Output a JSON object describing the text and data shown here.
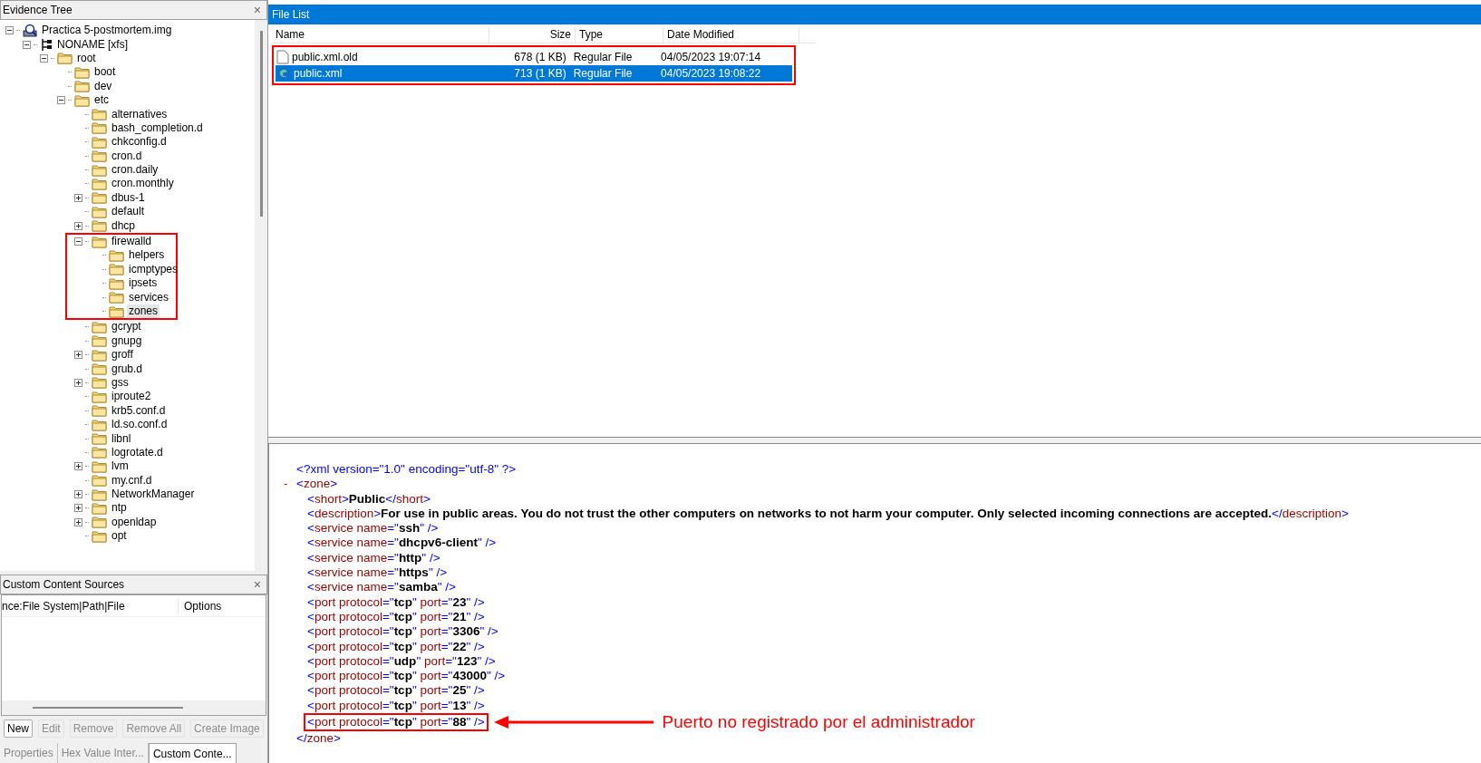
{
  "evidence_tree": {
    "title": "Evidence Tree",
    "close": "×",
    "nodes": [
      {
        "label": "Practica 5-postmortem.img",
        "kind": "image",
        "expanded": true,
        "selected": false,
        "highlighted": false,
        "children": [
          {
            "label": "NONAME [xfs]",
            "kind": "volume",
            "expanded": true,
            "selected": false,
            "highlighted": false,
            "children": [
              {
                "label": "root",
                "kind": "folder",
                "expanded": true,
                "selected": false,
                "highlighted": false,
                "children": [
                  {
                    "label": "boot",
                    "kind": "folder",
                    "selected": false,
                    "highlighted": false
                  },
                  {
                    "label": "dev",
                    "kind": "folder",
                    "selected": false,
                    "highlighted": false
                  },
                  {
                    "label": "etc",
                    "kind": "folder",
                    "expanded": true,
                    "selected": false,
                    "highlighted": false,
                    "children": [
                      {
                        "label": "alternatives",
                        "kind": "folder",
                        "selected": false,
                        "highlighted": false
                      },
                      {
                        "label": "bash_completion.d",
                        "kind": "folder",
                        "selected": false,
                        "highlighted": false
                      },
                      {
                        "label": "chkconfig.d",
                        "kind": "folder",
                        "selected": false,
                        "highlighted": false
                      },
                      {
                        "label": "cron.d",
                        "kind": "folder",
                        "selected": false,
                        "highlighted": false
                      },
                      {
                        "label": "cron.daily",
                        "kind": "folder",
                        "selected": false,
                        "highlighted": false
                      },
                      {
                        "label": "cron.monthly",
                        "kind": "folder",
                        "selected": false,
                        "highlighted": false
                      },
                      {
                        "label": "dbus-1",
                        "kind": "folder",
                        "expanded": false,
                        "selected": false,
                        "highlighted": false
                      },
                      {
                        "label": "default",
                        "kind": "folder",
                        "selected": false,
                        "highlighted": false
                      },
                      {
                        "label": "dhcp",
                        "kind": "folder",
                        "expanded": false,
                        "selected": false,
                        "highlighted": false
                      },
                      {
                        "label": "firewalld",
                        "kind": "folder",
                        "expanded": true,
                        "selected": false,
                        "highlighted": true,
                        "children": [
                          {
                            "label": "helpers",
                            "kind": "folder",
                            "selected": false,
                            "highlighted": false
                          },
                          {
                            "label": "icmptypes",
                            "kind": "folder",
                            "selected": false,
                            "highlighted": false
                          },
                          {
                            "label": "ipsets",
                            "kind": "folder",
                            "selected": false,
                            "highlighted": false
                          },
                          {
                            "label": "services",
                            "kind": "folder",
                            "selected": false,
                            "highlighted": false
                          },
                          {
                            "label": "zones",
                            "kind": "folder",
                            "selected": true,
                            "highlighted": false
                          }
                        ]
                      },
                      {
                        "label": "gcrypt",
                        "kind": "folder",
                        "selected": false,
                        "highlighted": false
                      },
                      {
                        "label": "gnupg",
                        "kind": "folder",
                        "selected": false,
                        "highlighted": false
                      },
                      {
                        "label": "groff",
                        "kind": "folder",
                        "expanded": false,
                        "selected": false,
                        "highlighted": false
                      },
                      {
                        "label": "grub.d",
                        "kind": "folder",
                        "selected": false,
                        "highlighted": false
                      },
                      {
                        "label": "gss",
                        "kind": "folder",
                        "expanded": false,
                        "selected": false,
                        "highlighted": false
                      },
                      {
                        "label": "iproute2",
                        "kind": "folder",
                        "selected": false,
                        "highlighted": false
                      },
                      {
                        "label": "krb5.conf.d",
                        "kind": "folder",
                        "selected": false,
                        "highlighted": false
                      },
                      {
                        "label": "ld.so.conf.d",
                        "kind": "folder",
                        "selected": false,
                        "highlighted": false
                      },
                      {
                        "label": "libnl",
                        "kind": "folder",
                        "selected": false,
                        "highlighted": false
                      },
                      {
                        "label": "logrotate.d",
                        "kind": "folder",
                        "selected": false,
                        "highlighted": false
                      },
                      {
                        "label": "lvm",
                        "kind": "folder",
                        "expanded": false,
                        "selected": false,
                        "highlighted": false
                      },
                      {
                        "label": "my.cnf.d",
                        "kind": "folder",
                        "selected": false,
                        "highlighted": false
                      },
                      {
                        "label": "NetworkManager",
                        "kind": "folder",
                        "expanded": false,
                        "selected": false,
                        "highlighted": false
                      },
                      {
                        "label": "ntp",
                        "kind": "folder",
                        "expanded": false,
                        "selected": false,
                        "highlighted": false
                      },
                      {
                        "label": "openldap",
                        "kind": "folder",
                        "expanded": false,
                        "selected": false,
                        "highlighted": false
                      },
                      {
                        "label": "opt",
                        "kind": "folder",
                        "selected": false,
                        "highlighted": false
                      }
                    ]
                  }
                ]
              }
            ]
          }
        ]
      }
    ]
  },
  "custom_content_sources": {
    "title": "Custom Content Sources",
    "close": "×",
    "columns": [
      "nce:File System|Path|File",
      "Options"
    ],
    "buttons": [
      {
        "label": "New",
        "disabled": false
      },
      {
        "label": "Edit",
        "disabled": true
      },
      {
        "label": "Remove",
        "disabled": true
      },
      {
        "label": "Remove All",
        "disabled": true
      },
      {
        "label": "Create Image",
        "disabled": true
      }
    ]
  },
  "bottom_tabs": [
    {
      "label": "Properties",
      "selected": false
    },
    {
      "label": "Hex Value Inter...",
      "selected": false
    },
    {
      "label": "Custom Conte...",
      "selected": true
    }
  ],
  "file_list": {
    "title": "File List",
    "columns": [
      "Name",
      "Size",
      "Type",
      "Date Modified"
    ],
    "highlighted": true,
    "rows": [
      {
        "name": "public.xml.old",
        "kind": "document",
        "size": "678 (1 KB)",
        "type": "Regular File",
        "date": "04/05/2023 19:07:14",
        "selected": false
      },
      {
        "name": "public.xml",
        "kind": "web",
        "size": "713 (1 KB)",
        "type": "Regular File",
        "date": "04/05/2023 19:08:22",
        "selected": true
      }
    ]
  },
  "xml_view": {
    "declaration": [
      {
        "kind": "punct",
        "text": "<?"
      },
      {
        "kind": "punct",
        "text": "xml version=\"1.0\" encoding=\"utf-8\" ?>"
      }
    ],
    "root": {
      "toggle": "-",
      "open": [
        {
          "kind": "punct",
          "text": "<"
        },
        {
          "kind": "name",
          "text": "zone"
        },
        {
          "kind": "punct",
          "text": ">"
        }
      ],
      "lines": [
        {
          "highlighted": false,
          "segments": [
            {
              "kind": "punct",
              "text": "<"
            },
            {
              "kind": "name",
              "text": "short"
            },
            {
              "kind": "punct",
              "text": ">"
            },
            {
              "kind": "value",
              "text": "Public"
            },
            {
              "kind": "punct",
              "text": "</"
            },
            {
              "kind": "name",
              "text": "short"
            },
            {
              "kind": "punct",
              "text": ">"
            }
          ]
        },
        {
          "highlighted": false,
          "segments": [
            {
              "kind": "punct",
              "text": "<"
            },
            {
              "kind": "name",
              "text": "description"
            },
            {
              "kind": "punct",
              "text": ">"
            },
            {
              "kind": "value",
              "text": "For use in public areas. You do not trust the other computers on networks to not harm your computer. Only selected incoming connections are accepted."
            },
            {
              "kind": "punct",
              "text": "</"
            },
            {
              "kind": "name",
              "text": "description"
            },
            {
              "kind": "punct",
              "text": ">"
            }
          ]
        },
        {
          "highlighted": false,
          "segments": [
            {
              "kind": "punct",
              "text": "<"
            },
            {
              "kind": "name",
              "text": "service name"
            },
            {
              "kind": "punct",
              "text": "=\""
            },
            {
              "kind": "value",
              "text": "ssh"
            },
            {
              "kind": "punct",
              "text": "\" />"
            }
          ]
        },
        {
          "highlighted": false,
          "segments": [
            {
              "kind": "punct",
              "text": "<"
            },
            {
              "kind": "name",
              "text": "service name"
            },
            {
              "kind": "punct",
              "text": "=\""
            },
            {
              "kind": "value",
              "text": "dhcpv6-client"
            },
            {
              "kind": "punct",
              "text": "\" />"
            }
          ]
        },
        {
          "highlighted": false,
          "segments": [
            {
              "kind": "punct",
              "text": "<"
            },
            {
              "kind": "name",
              "text": "service name"
            },
            {
              "kind": "punct",
              "text": "=\""
            },
            {
              "kind": "value",
              "text": "http"
            },
            {
              "kind": "punct",
              "text": "\" />"
            }
          ]
        },
        {
          "highlighted": false,
          "segments": [
            {
              "kind": "punct",
              "text": "<"
            },
            {
              "kind": "name",
              "text": "service name"
            },
            {
              "kind": "punct",
              "text": "=\""
            },
            {
              "kind": "value",
              "text": "https"
            },
            {
              "kind": "punct",
              "text": "\" />"
            }
          ]
        },
        {
          "highlighted": false,
          "segments": [
            {
              "kind": "punct",
              "text": "<"
            },
            {
              "kind": "name",
              "text": "service name"
            },
            {
              "kind": "punct",
              "text": "=\""
            },
            {
              "kind": "value",
              "text": "samba"
            },
            {
              "kind": "punct",
              "text": "\" />"
            }
          ]
        },
        {
          "highlighted": false,
          "segments": [
            {
              "kind": "punct",
              "text": "<"
            },
            {
              "kind": "name",
              "text": "port protocol"
            },
            {
              "kind": "punct",
              "text": "=\""
            },
            {
              "kind": "value",
              "text": "tcp"
            },
            {
              "kind": "punct",
              "text": "\""
            },
            {
              "kind": "name",
              "text": " port"
            },
            {
              "kind": "punct",
              "text": "=\""
            },
            {
              "kind": "value",
              "text": "23"
            },
            {
              "kind": "punct",
              "text": "\" />"
            }
          ]
        },
        {
          "highlighted": false,
          "segments": [
            {
              "kind": "punct",
              "text": "<"
            },
            {
              "kind": "name",
              "text": "port protocol"
            },
            {
              "kind": "punct",
              "text": "=\""
            },
            {
              "kind": "value",
              "text": "tcp"
            },
            {
              "kind": "punct",
              "text": "\""
            },
            {
              "kind": "name",
              "text": " port"
            },
            {
              "kind": "punct",
              "text": "=\""
            },
            {
              "kind": "value",
              "text": "21"
            },
            {
              "kind": "punct",
              "text": "\" />"
            }
          ]
        },
        {
          "highlighted": false,
          "segments": [
            {
              "kind": "punct",
              "text": "<"
            },
            {
              "kind": "name",
              "text": "port protocol"
            },
            {
              "kind": "punct",
              "text": "=\""
            },
            {
              "kind": "value",
              "text": "tcp"
            },
            {
              "kind": "punct",
              "text": "\""
            },
            {
              "kind": "name",
              "text": " port"
            },
            {
              "kind": "punct",
              "text": "=\""
            },
            {
              "kind": "value",
              "text": "3306"
            },
            {
              "kind": "punct",
              "text": "\" />"
            }
          ]
        },
        {
          "highlighted": false,
          "segments": [
            {
              "kind": "punct",
              "text": "<"
            },
            {
              "kind": "name",
              "text": "port protocol"
            },
            {
              "kind": "punct",
              "text": "=\""
            },
            {
              "kind": "value",
              "text": "tcp"
            },
            {
              "kind": "punct",
              "text": "\""
            },
            {
              "kind": "name",
              "text": " port"
            },
            {
              "kind": "punct",
              "text": "=\""
            },
            {
              "kind": "value",
              "text": "22"
            },
            {
              "kind": "punct",
              "text": "\" />"
            }
          ]
        },
        {
          "highlighted": false,
          "segments": [
            {
              "kind": "punct",
              "text": "<"
            },
            {
              "kind": "name",
              "text": "port protocol"
            },
            {
              "kind": "punct",
              "text": "=\""
            },
            {
              "kind": "value",
              "text": "udp"
            },
            {
              "kind": "punct",
              "text": "\""
            },
            {
              "kind": "name",
              "text": " port"
            },
            {
              "kind": "punct",
              "text": "=\""
            },
            {
              "kind": "value",
              "text": "123"
            },
            {
              "kind": "punct",
              "text": "\" />"
            }
          ]
        },
        {
          "highlighted": false,
          "segments": [
            {
              "kind": "punct",
              "text": "<"
            },
            {
              "kind": "name",
              "text": "port protocol"
            },
            {
              "kind": "punct",
              "text": "=\""
            },
            {
              "kind": "value",
              "text": "tcp"
            },
            {
              "kind": "punct",
              "text": "\""
            },
            {
              "kind": "name",
              "text": " port"
            },
            {
              "kind": "punct",
              "text": "=\""
            },
            {
              "kind": "value",
              "text": "43000"
            },
            {
              "kind": "punct",
              "text": "\" />"
            }
          ]
        },
        {
          "highlighted": false,
          "segments": [
            {
              "kind": "punct",
              "text": "<"
            },
            {
              "kind": "name",
              "text": "port protocol"
            },
            {
              "kind": "punct",
              "text": "=\""
            },
            {
              "kind": "value",
              "text": "tcp"
            },
            {
              "kind": "punct",
              "text": "\""
            },
            {
              "kind": "name",
              "text": " port"
            },
            {
              "kind": "punct",
              "text": "=\""
            },
            {
              "kind": "value",
              "text": "25"
            },
            {
              "kind": "punct",
              "text": "\" />"
            }
          ]
        },
        {
          "highlighted": false,
          "segments": [
            {
              "kind": "punct",
              "text": "<"
            },
            {
              "kind": "name",
              "text": "port protocol"
            },
            {
              "kind": "punct",
              "text": "=\""
            },
            {
              "kind": "value",
              "text": "tcp"
            },
            {
              "kind": "punct",
              "text": "\""
            },
            {
              "kind": "name",
              "text": " port"
            },
            {
              "kind": "punct",
              "text": "=\""
            },
            {
              "kind": "value",
              "text": "13"
            },
            {
              "kind": "punct",
              "text": "\" />"
            }
          ]
        },
        {
          "highlighted": true,
          "segments": [
            {
              "kind": "punct",
              "text": "<"
            },
            {
              "kind": "name",
              "text": "port protocol"
            },
            {
              "kind": "punct",
              "text": "=\""
            },
            {
              "kind": "value",
              "text": "tcp"
            },
            {
              "kind": "punct",
              "text": "\""
            },
            {
              "kind": "name",
              "text": " port"
            },
            {
              "kind": "punct",
              "text": "=\""
            },
            {
              "kind": "value",
              "text": "88"
            },
            {
              "kind": "punct",
              "text": "\" />"
            }
          ],
          "annotation": "Puerto no registrado por el administrador"
        }
      ],
      "close": [
        {
          "kind": "punct",
          "text": "</"
        },
        {
          "kind": "name",
          "text": "zone"
        },
        {
          "kind": "punct",
          "text": ">"
        }
      ]
    }
  }
}
